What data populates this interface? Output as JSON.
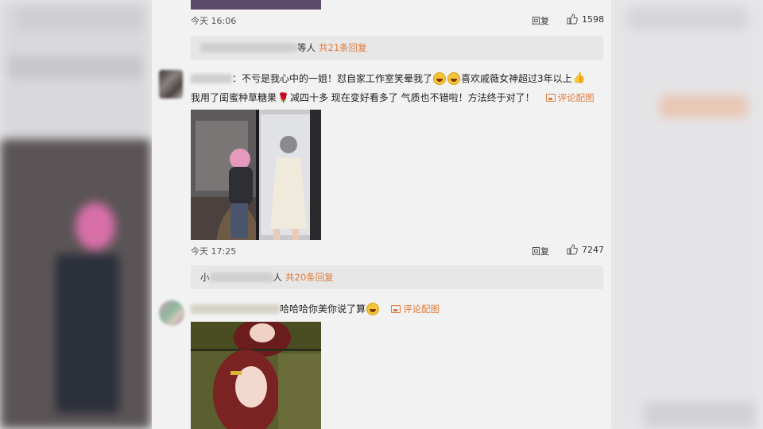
{
  "comments": [
    {
      "time": "今天 16:06",
      "reply_label": "回复",
      "likes": "1598",
      "replies_summary": {
        "suffix": "等人",
        "count_text": "共21条回复"
      }
    },
    {
      "name_tail": "：",
      "text_line1": "不亏是我心中的一姐！怼自家工作室笑晕我了",
      "text_line1b": "喜欢戚薇女神超过3年以上",
      "text_line2a": "我用了闺蜜种草糖果",
      "text_line2b": "减四十多 现在变好看多了 气质也不错啦！方法终于对了！",
      "pic_link": "评论配图",
      "time": "今天 17:25",
      "reply_label": "回复",
      "likes": "7247",
      "replies_summary": {
        "prefix": "小",
        "suffix": "人",
        "count_text": "共20条回复"
      }
    },
    {
      "text": "哈哈哈你美你说了算",
      "pic_link": "评论配图"
    }
  ],
  "icons": {
    "like": "thumbs-up-icon",
    "picture": "picture-icon",
    "emoji_laugh": "laughing-emoji-icon",
    "emoji_thumb": "thumbs-up-emoji-icon"
  },
  "colors": {
    "accent": "#e17a39",
    "feed_bg": "#f2f2f2"
  }
}
